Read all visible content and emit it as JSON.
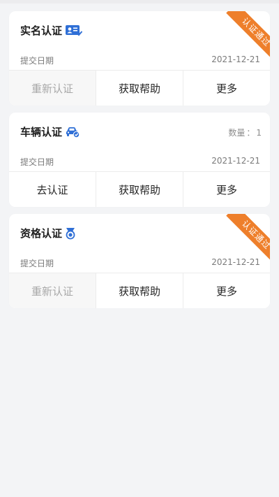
{
  "colors": {
    "accent_blue": "#2f6fd6",
    "ribbon_orange": "#ee7f2b",
    "background": "#f3f4f6"
  },
  "cards": [
    {
      "title": "实名认证",
      "icon": "id-card-check-icon",
      "ribbon": "认证通过",
      "date_label": "提交日期",
      "date_value": "2021-12-21",
      "actions": [
        "重新认证",
        "获取帮助",
        "更多"
      ]
    },
    {
      "title": "车辆认证",
      "icon": "car-check-icon",
      "count_label": "数量",
      "count_sep": "：",
      "count_value": "1",
      "date_label": "提交日期",
      "date_value": "2021-12-21",
      "actions": [
        "去认证",
        "获取帮助",
        "更多"
      ]
    },
    {
      "title": "资格认证",
      "icon": "qualification-medal-icon",
      "ribbon": "认证通过",
      "date_label": "提交日期",
      "date_value": "2021-12-21",
      "actions": [
        "重新认证",
        "获取帮助",
        "更多"
      ]
    }
  ]
}
